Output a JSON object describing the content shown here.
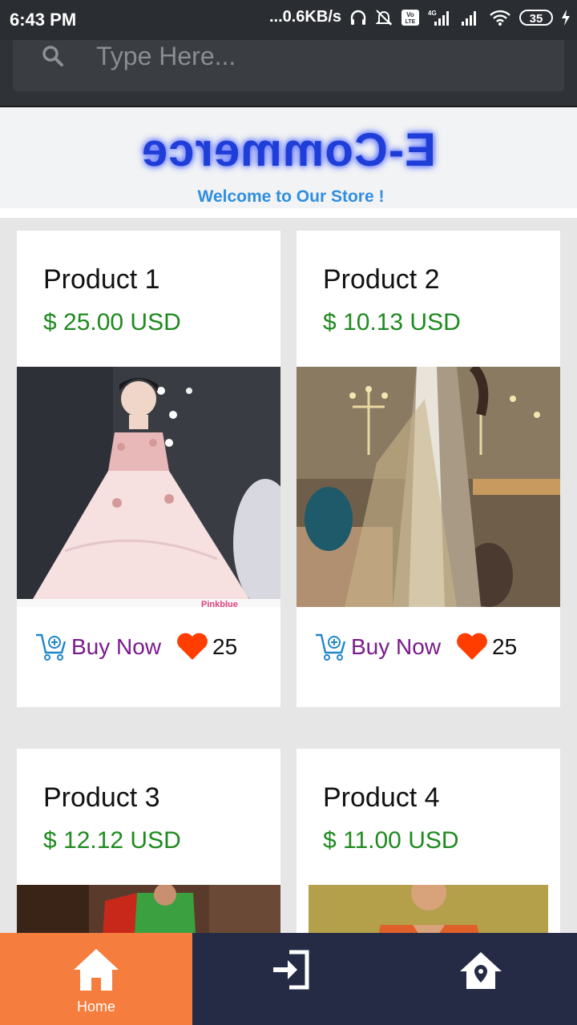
{
  "status_bar": {
    "time": "6:43 PM",
    "network_speed": "...0.6KB/s",
    "battery": "35",
    "icons": [
      "headset-icon",
      "bell-off-icon",
      "volte-icon",
      "signal-4g-icon",
      "signal-icon",
      "wifi-icon",
      "battery-icon",
      "charging-icon"
    ]
  },
  "search": {
    "placeholder": "Type Here..."
  },
  "banner": {
    "logo_text": "E-Commerce",
    "tagline": "Welcome to Our Store !"
  },
  "products": [
    {
      "title": "Product 1",
      "price": "$ 25.00 USD",
      "buy_label": "Buy Now",
      "likes": "25",
      "image": "pink-dress-photo"
    },
    {
      "title": "Product 2",
      "price": "$ 10.13 USD",
      "buy_label": "Buy Now",
      "likes": "25",
      "image": "embroidered-dress-photo"
    },
    {
      "title": "Product 3",
      "price": "$ 12.12 USD",
      "image": "red-green-dress-photo"
    },
    {
      "title": "Product 4",
      "price": "$ 11.00 USD",
      "image": "orange-top-photo"
    }
  ],
  "nav": {
    "items": [
      {
        "label": "Home",
        "icon": "home-icon",
        "active": true
      },
      {
        "label": "",
        "icon": "login-icon",
        "active": false
      },
      {
        "label": "",
        "icon": "home-location-icon",
        "active": false
      }
    ]
  },
  "colors": {
    "price": "#1f8a1f",
    "buy": "#7a1b8c",
    "heart": "#ff3d00",
    "nav_active": "#f57d3d",
    "nav_bg": "#252b45"
  }
}
